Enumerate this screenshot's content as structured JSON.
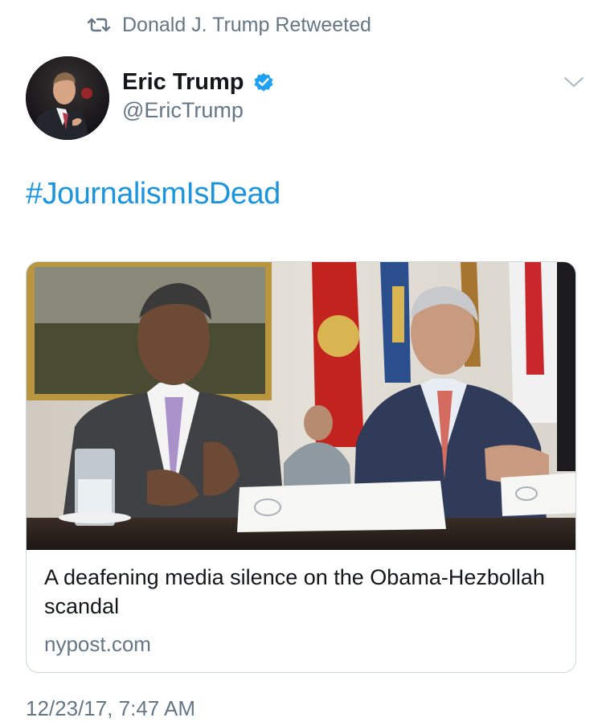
{
  "retweet": {
    "icon": "retweet-icon",
    "text": "Donald J. Trump Retweeted"
  },
  "tweet": {
    "author_name": "Eric Trump",
    "author_handle": "@EricTrump",
    "verified_icon": "verified-badge-icon",
    "menu_icon": "chevron-down-icon",
    "text": "#JournalismIsDead",
    "timestamp": "12/23/17, 7:47 AM"
  },
  "card": {
    "title": "A deafening media silence on the Obama-Hezbollah scandal",
    "domain": "nypost.com"
  },
  "colors": {
    "link": "#1b95e0",
    "secondary_text": "#657786",
    "primary_text": "#14171a",
    "verified": "#1da1f2",
    "border": "#ccd6dd"
  }
}
